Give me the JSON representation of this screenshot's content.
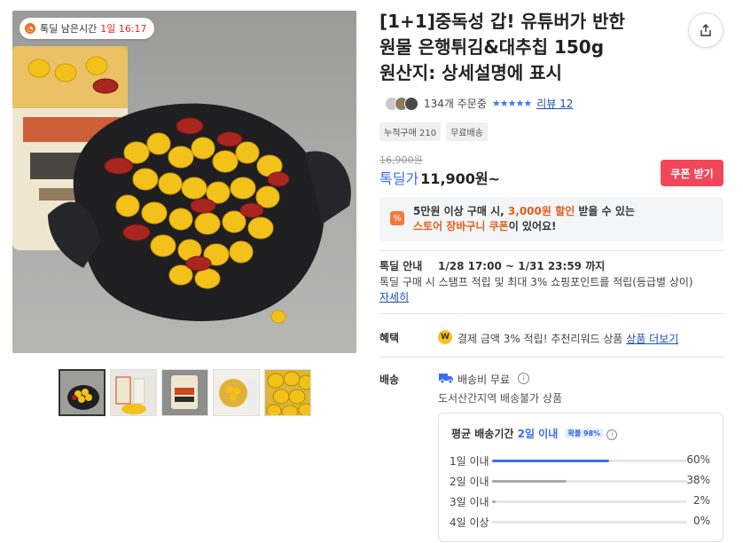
{
  "timer": {
    "label": "톡딜 남은시간",
    "remaining": "1일 16:17"
  },
  "product": {
    "title_line1": "[1+1]중독성 갑! 유튜버가 반한",
    "title_line2": "원물 은행튀김&대추칩 150g",
    "title_line3": "원산지: 상세설명에 표시",
    "orders": "134개 주문중",
    "stars": "★★★★★",
    "review": "리뷰 12",
    "tags": [
      "누적구매 210",
      "무료배송"
    ]
  },
  "price": {
    "original": "16,900원",
    "label": "톡딜가",
    "value": "11,900원~",
    "coupon_button": "쿠폰 받기"
  },
  "promo": {
    "icon": "%",
    "line1_a": "5만원 이상 구매 시, ",
    "line1_b": "3,000원 할인",
    "line1_c": " 받을 수 있는",
    "line2_a": "스토어 장바구니 쿠폰",
    "line2_b": "이 있어요!"
  },
  "deal": {
    "label": "톡딜 안내",
    "period": "1/28 17:00 ~ 1/31 23:59 까지",
    "desc": "톡딜 구매 시 스탬프 적립 및 최대 3% 쇼핑포인트를 적립(등급별 상이)",
    "more": "자세히"
  },
  "benefit": {
    "label": "혜택",
    "icon": "W",
    "text": "결제 금액 3% 적립! 추천리워드 상품",
    "more": "상품 더보기"
  },
  "shipping": {
    "label": "배송",
    "fee": "배송비 무료",
    "note": "도서산간지역 배송불가 상품",
    "avg_label": "평균 배송기간",
    "avg_value": "2일 이내",
    "rate": "확률 98%",
    "rows": [
      {
        "label": "1일 이내",
        "pct": "60%",
        "value": 60,
        "color": "#3b6df2"
      },
      {
        "label": "2일 이내",
        "pct": "38%",
        "value": 38,
        "color": "#a9a9a9"
      },
      {
        "label": "3일 이내",
        "pct": "2%",
        "value": 2,
        "color": "#a9a9a9"
      },
      {
        "label": "4일 이상",
        "pct": "0%",
        "value": 0,
        "color": "#a9a9a9"
      }
    ]
  },
  "icons": {
    "share": "share-icon",
    "info": "info-icon",
    "truck": "truck-icon"
  }
}
